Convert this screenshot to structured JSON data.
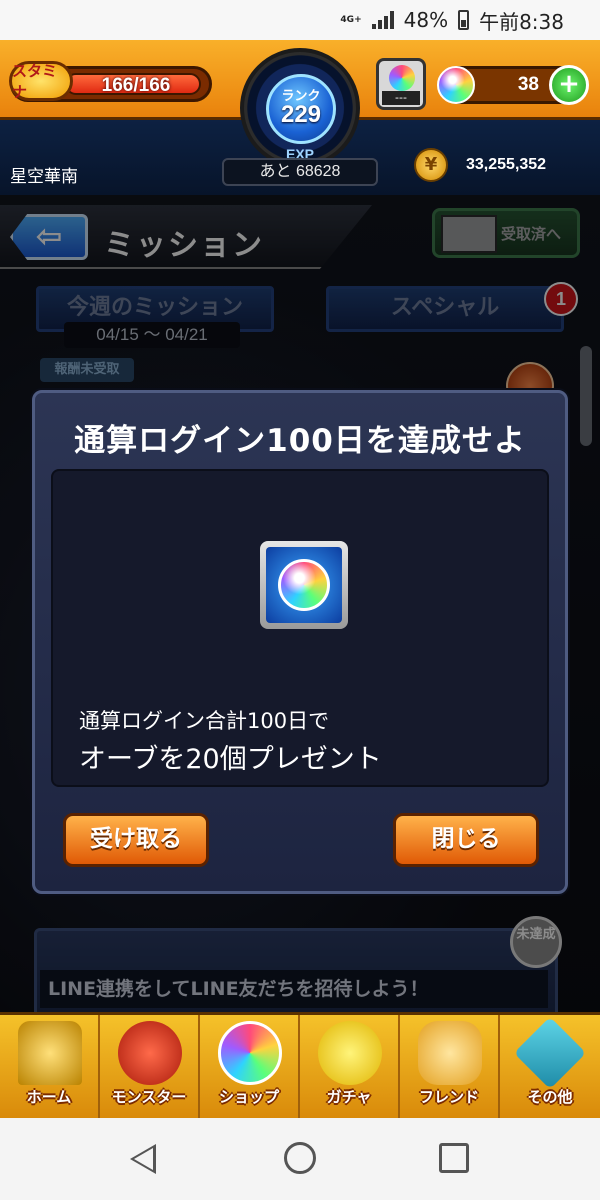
{
  "status_bar": {
    "network": "4G+",
    "battery": "48%",
    "time": "午前8:38"
  },
  "hud": {
    "stamina_badge": "スタミナ",
    "stamina": "166/166",
    "rank_label": "ランク",
    "rank": "229",
    "exp_label": "EXP",
    "exp_remaining": "あと 68628",
    "orb_slot": "---",
    "orbs": "38",
    "player_name": "星空華南",
    "gold": "33,255,352"
  },
  "header": {
    "title": "ミッション",
    "received_button": "受取済へ"
  },
  "tabs": {
    "weekly": "今週のミッション",
    "weekly_dates": "04/15 ～ 04/21",
    "special": "スペシャル",
    "special_badge": "1"
  },
  "background": {
    "chip": "報酬未受取",
    "card_text": "LINE連携をしてLINE友だちを招待しよう！",
    "card_status": "未達成"
  },
  "modal": {
    "title": "通算ログイン100日を達成せよ",
    "desc_line1": "通算ログイン合計100日で",
    "desc_line2": "オーブを20個プレゼント",
    "receive_button": "受け取る",
    "close_button": "閉じる"
  },
  "bottom_nav": [
    {
      "label": "ホーム",
      "icon": "home-icon"
    },
    {
      "label": "モンスター",
      "icon": "monster-icon"
    },
    {
      "label": "ショップ",
      "icon": "orb-icon"
    },
    {
      "label": "ガチャ",
      "icon": "gacha-egg-icon"
    },
    {
      "label": "フレンド",
      "icon": "friend-icon"
    },
    {
      "label": "その他",
      "icon": "other-icon"
    }
  ]
}
